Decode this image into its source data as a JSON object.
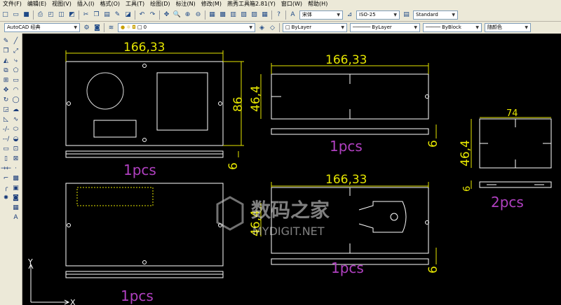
{
  "menu": [
    "文件(F)",
    "编辑(E)",
    "视图(V)",
    "插入(I)",
    "格式(O)",
    "工具(T)",
    "绘图(D)",
    "标注(N)",
    "修改(M)",
    "燕秀工具箱2.81(Y)",
    "窗口(W)",
    "帮助(H)"
  ],
  "toolbar1": {
    "font_combo": "宋体",
    "dimstyle_combo": "ISO-25",
    "textstyle_combo": "Standard"
  },
  "toolbar2": {
    "workspace_combo": "AutoCAD 经典",
    "layer_combo": "0",
    "color_combo": "ByLayer",
    "linetype_combo": "ByLayer",
    "lineweight_combo": "ByBlock",
    "plotstyle_combo": "随颜色"
  },
  "drawing": {
    "dims": {
      "d1": "166,33",
      "d2": "86",
      "d3": "6",
      "d4": "166,33",
      "d5": "46,4",
      "d6": "6",
      "d7": "74",
      "d8": "46,4",
      "d9": "6",
      "d10": "166,33",
      "d11": "46,4",
      "d12": "6"
    },
    "labels": {
      "l1": "1pcs",
      "l2": "1pcs",
      "l3": "2pcs",
      "l4": "1pcs",
      "l5": "1pcs"
    },
    "ucs": {
      "y": "Y",
      "x": "X"
    },
    "watermark": {
      "cn": "数码之家",
      "en": "MYDIGIT.NET"
    }
  },
  "colors": {
    "canvas": "#000000",
    "dim": "#e6e600",
    "part": "#ffffff",
    "label": "#b040c0",
    "circle": "#e0e0e0"
  }
}
